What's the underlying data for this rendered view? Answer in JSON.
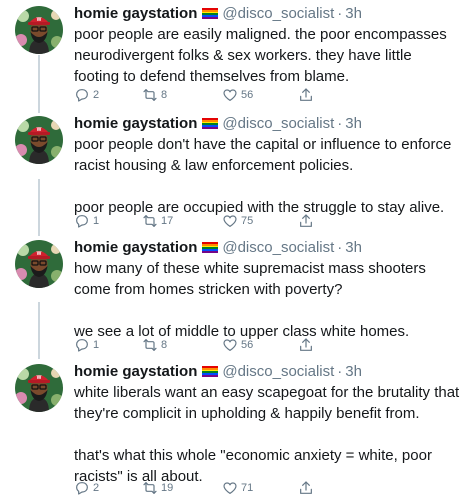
{
  "colors": {
    "text": "#14171a",
    "secondary": "#657786",
    "thread_line": "#ccd6dd",
    "background": "#ffffff"
  },
  "flag_colors": [
    "#e40303",
    "#ff8c00",
    "#ffed00",
    "#008026",
    "#004dff",
    "#750787"
  ],
  "author": {
    "name": "homie gaystation",
    "flag_icon": "rainbow-flag-icon",
    "handle": "@disco_socialist",
    "separator": "·"
  },
  "tweets": [
    {
      "time": "3h",
      "text": "poor people are easily maligned. the poor encompasses neurodivergent folks & sex workers. they have little footing to defend themselves from blame.",
      "replies": "2",
      "retweets": "8",
      "likes": "56"
    },
    {
      "time": "3h",
      "text": "poor people don't have the capital or influence to enforce racist housing & law enforcement policies.\n\npoor people are occupied with the struggle to stay alive.",
      "replies": "1",
      "retweets": "17",
      "likes": "75"
    },
    {
      "time": "3h",
      "text": "how many of these white supremacist mass shooters come from homes stricken with poverty?\n\nwe see a lot of middle to upper class white homes.",
      "replies": "1",
      "retweets": "8",
      "likes": "56"
    },
    {
      "time": "3h",
      "text": "white liberals want an easy scapegoat for the brutality that they're complicit in upholding & happily benefit from.\n\nthat's what this whole \"economic anxiety = white, poor racists\" is all about.",
      "replies": "2",
      "retweets": "19",
      "likes": "71"
    }
  ]
}
